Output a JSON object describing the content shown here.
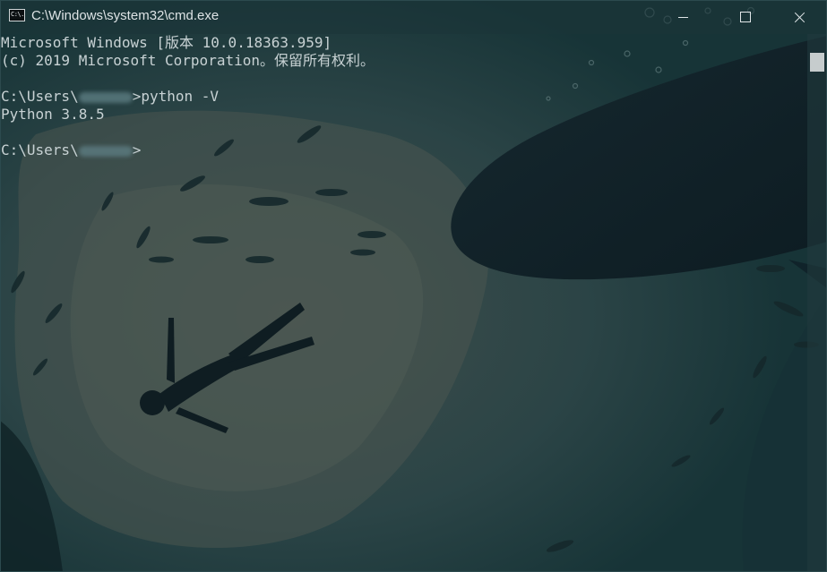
{
  "window": {
    "title": "C:\\Windows\\system32\\cmd.exe",
    "icon": "cmd-icon",
    "icon_text": "C:\\."
  },
  "controls": {
    "minimize_icon": "minimize-icon",
    "maximize_icon": "maximize-icon",
    "close_icon": "close-icon"
  },
  "console": {
    "lines": [
      {
        "text": "Microsoft Windows [版本 10.0.18363.959]"
      },
      {
        "text": "(c) 2019 Microsoft Corporation。保留所有权利。"
      },
      {
        "text": ""
      },
      {
        "prefix": "C:\\Users\\",
        "suffix": ">python -V"
      },
      {
        "text": "Python 3.8.5"
      },
      {
        "text": ""
      },
      {
        "prefix": "C:\\Users\\",
        "suffix": ">"
      }
    ]
  },
  "colors": {
    "text": "#c8d2d4",
    "background": "#1b3b3f",
    "titlebar": "#1c3438"
  }
}
